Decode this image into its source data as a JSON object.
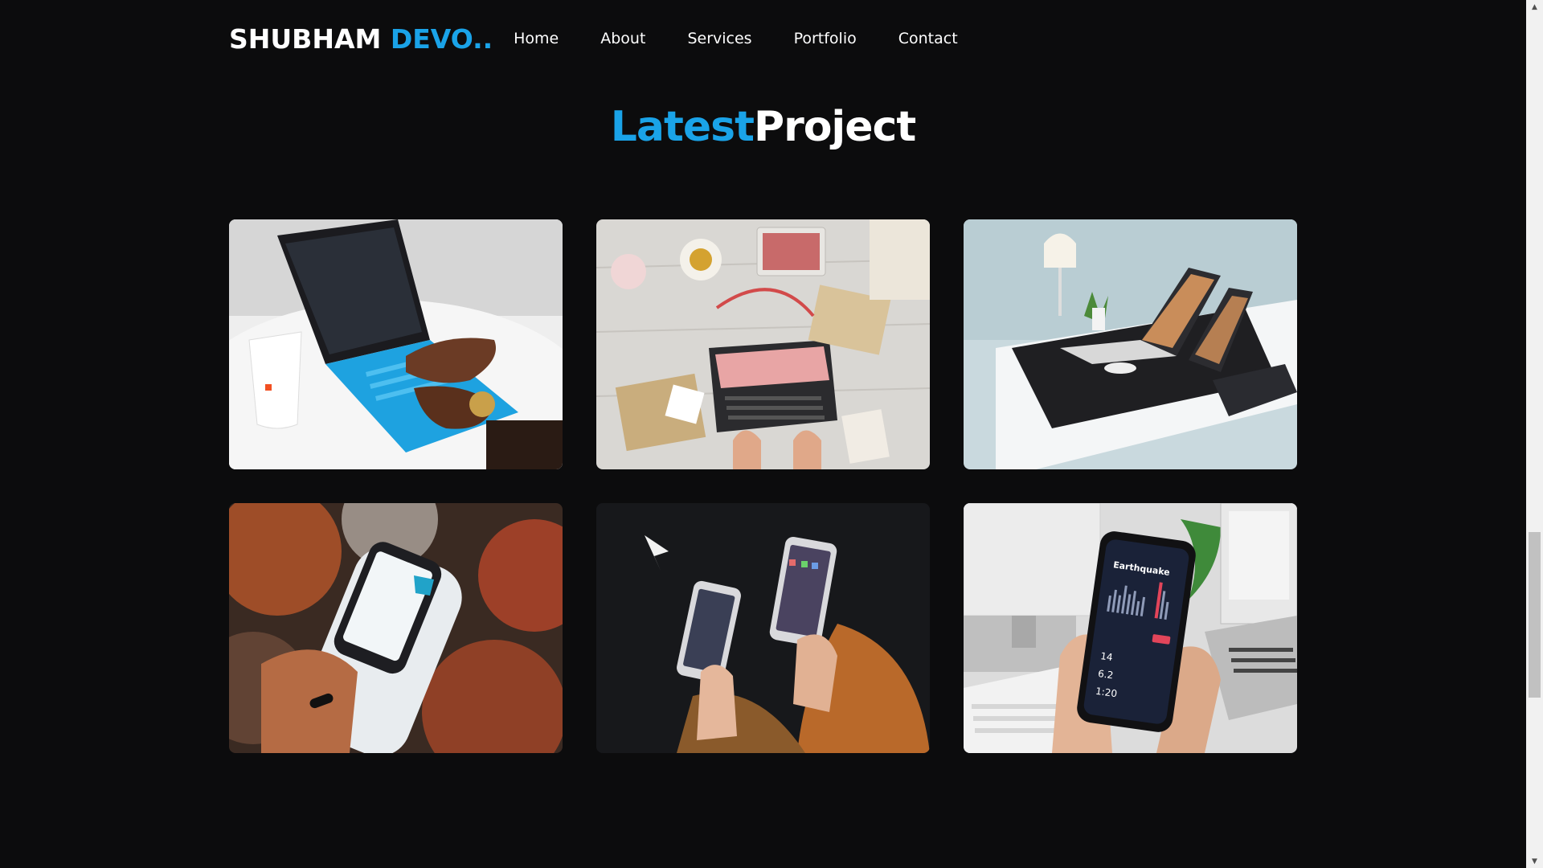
{
  "brand": {
    "name_main": "SHUBHAM",
    "name_accent": "DEVO..",
    "accent_color": "#1aa3e8"
  },
  "nav": {
    "items": [
      {
        "label": "Home"
      },
      {
        "label": "About"
      },
      {
        "label": "Services"
      },
      {
        "label": "Portfolio"
      },
      {
        "label": "Contact"
      }
    ]
  },
  "section": {
    "title_accent": "Latest",
    "title_main": "Project"
  },
  "projects": [
    {
      "icon": "laptop-typing-image"
    },
    {
      "icon": "desk-flatlay-image"
    },
    {
      "icon": "workspace-desk-image"
    },
    {
      "icon": "handheld-scanner-image"
    },
    {
      "icon": "smartphones-image"
    },
    {
      "icon": "earthquake-app-image",
      "screen_title": "Earthquake",
      "stats": [
        "14",
        "6.2",
        "1:20"
      ]
    }
  ],
  "scrollbar": {
    "up_glyph": "▲",
    "down_glyph": "▼"
  }
}
